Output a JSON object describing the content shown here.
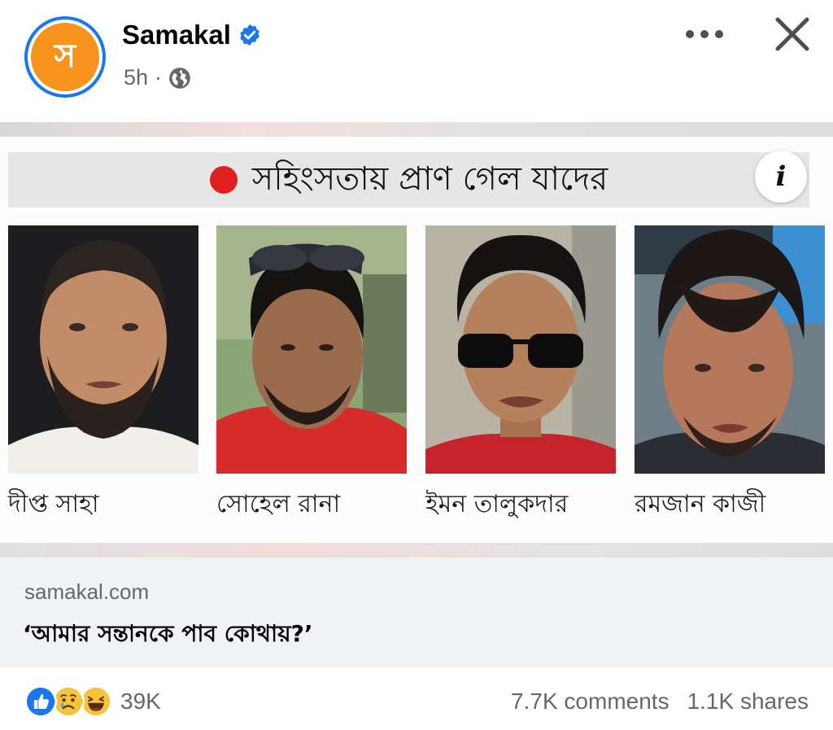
{
  "header": {
    "avatar_glyph": "স",
    "page_name": "Samakal",
    "time": "5h",
    "separator": "·",
    "accent_color": "#1877f2",
    "avatar_color": "#f7941d"
  },
  "image": {
    "banner_text": "সহিংসতায় প্রাণ গেল যাদের",
    "info_glyph": "i",
    "people": [
      {
        "name": "দীপ্ত সাহা"
      },
      {
        "name": "সোহেল রানা"
      },
      {
        "name": "ইমন তালুকদার"
      },
      {
        "name": "রমজান কাজী"
      }
    ]
  },
  "link": {
    "domain": "samakal.com",
    "title": "‘আমার সন্তানকে পাব কোথায়?’"
  },
  "footer": {
    "reaction_count": "39K",
    "comments": "7.7K comments",
    "shares": "1.1K shares",
    "reactions": [
      "like-icon",
      "sad-icon",
      "haha-icon"
    ]
  }
}
